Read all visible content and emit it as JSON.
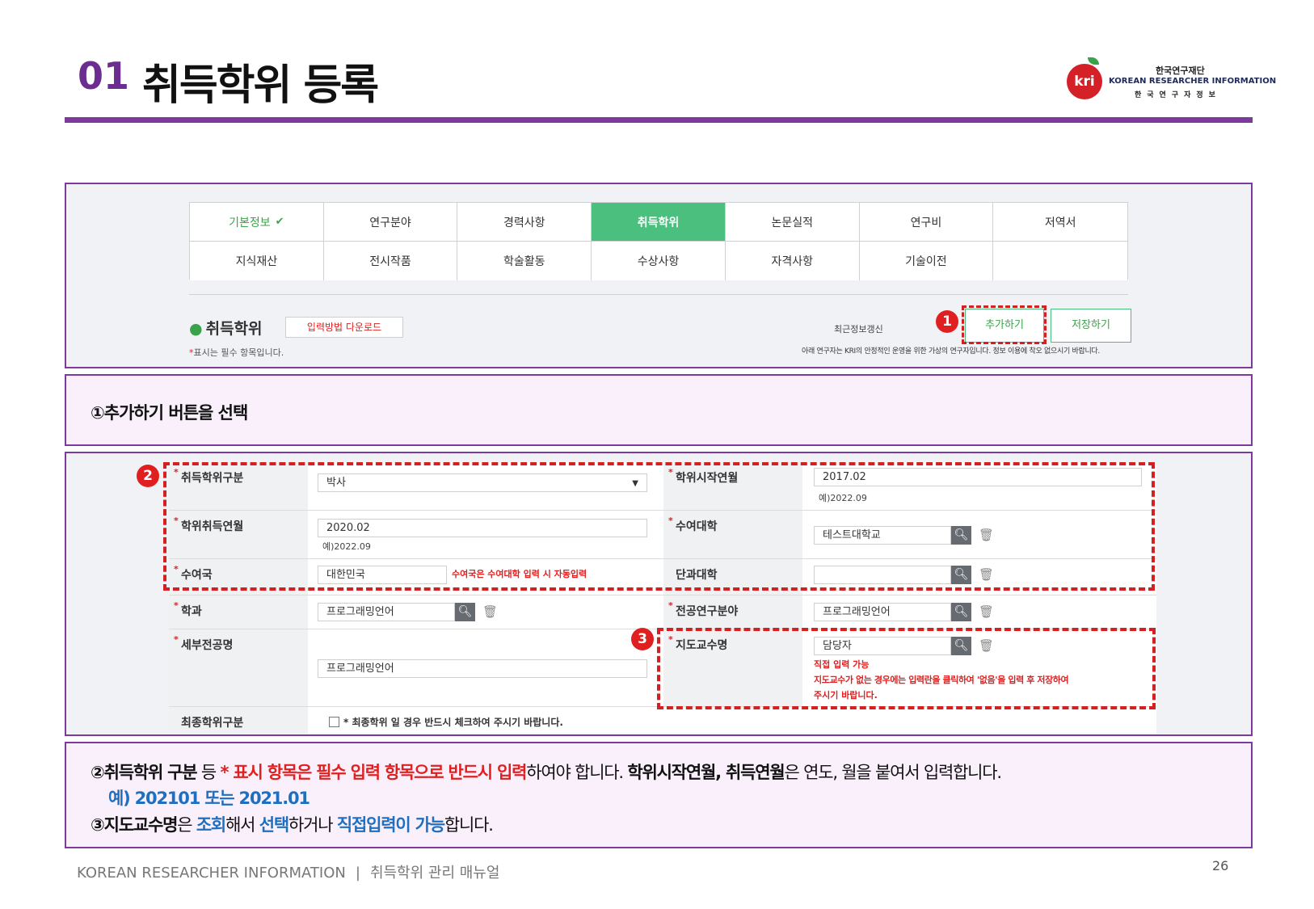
{
  "header": {
    "number": "01",
    "title": "취득학위 등록",
    "logo": {
      "mark": "kri",
      "line1": "한국연구재단",
      "line2": "KOREAN RESEARCHER INFORMATION",
      "line3": "한국연구자정보"
    }
  },
  "tabs": [
    {
      "label": "기본정보",
      "state": "done"
    },
    {
      "label": "연구분야",
      "state": "normal"
    },
    {
      "label": "경력사항",
      "state": "normal"
    },
    {
      "label": "취득학위",
      "state": "active"
    },
    {
      "label": "논문실적",
      "state": "normal"
    },
    {
      "label": "연구비",
      "state": "normal"
    },
    {
      "label": "저역서",
      "state": "normal"
    },
    {
      "label": "지식재산",
      "state": "normal"
    },
    {
      "label": "전시작품",
      "state": "normal"
    },
    {
      "label": "학술활동",
      "state": "normal"
    },
    {
      "label": "수상사항",
      "state": "normal"
    },
    {
      "label": "자격사항",
      "state": "normal"
    },
    {
      "label": "기술이전",
      "state": "normal"
    },
    {
      "label": "",
      "state": "normal"
    }
  ],
  "section": {
    "title": "취득학위",
    "download_label": "입력방법 다운로드",
    "required_note": "표시는 필수 항목입니다.",
    "recent_update": "최근정보갱신",
    "add_button": "추가하기",
    "save_button": "저장하기",
    "notice": "아래 연구자는 KRI의 안정적인 운영을 위한 가상의 연구자입니다. 정보 이용에 착오 없으시기 바랍니다."
  },
  "badges": {
    "one": "1",
    "two": "2",
    "three": "3"
  },
  "instruction1": "①추가하기 버튼을 선택",
  "form": {
    "degree_type": {
      "label": "취득학위구분",
      "value": "박사"
    },
    "degree_start": {
      "label": "학위시작연월",
      "value": "2017.02",
      "hint": "예)2022.09"
    },
    "degree_acquired": {
      "label": "학위취득연월",
      "value": "2020.02",
      "hint": "예)2022.09"
    },
    "university": {
      "label": "수여대학",
      "value": "테스트대학교"
    },
    "country": {
      "label": "수여국",
      "value": "대한민국",
      "note": "수여국은 수여대학 입력 시 자동입력"
    },
    "college": {
      "label": "단과대학",
      "value": ""
    },
    "department": {
      "label": "학과",
      "value": "프로그래밍언어"
    },
    "research_field": {
      "label": "전공연구분야",
      "value": "프로그래밍언어"
    },
    "sub_major": {
      "label": "세부전공명",
      "value": "프로그래밍언어"
    },
    "advisor": {
      "label": "지도교수명",
      "value": "담당자",
      "note1": "직접 입력 가능",
      "note2": "지도교수가 없는 경우에는 입력란을 클릭하여 '없음'을 입력 후 저장하여",
      "note3": "주시기 바랍니다."
    },
    "final_degree": {
      "label": "최종학위구분",
      "checkbox_label": "* 최종학위 일 경우 반드시 체크하여 주시기 바랍니다."
    }
  },
  "instruction2": {
    "p1": "②",
    "p2": "취득학위 구분",
    "p3": " 등 ",
    "p4": "* 표시 항목은 필수 입력 항목으로 반드시 입력",
    "p5": "하여야 합니다. ",
    "p6": "학위시작연월, 취득연월",
    "p7": "은 연도, 월을 붙여서 입력합니다."
  },
  "instruction2b": "예) 202101 또는 2021.01",
  "instruction3": {
    "p1": "③",
    "p2": "지도교수명",
    "p3": "은 ",
    "p4": "조회",
    "p5": "해서 ",
    "p6": "선택",
    "p7": "하거나 ",
    "p8": "직접입력이 가능",
    "p9": "합니다."
  },
  "footer": {
    "left": "KOREAN RESEARCHER INFORMATION",
    "separator": "|",
    "manual": "취득학위 관리 매뉴얼",
    "page": "26"
  },
  "colors": {
    "brand_purple": "#7b3a9c",
    "active_tab": "#4bbf7e",
    "highlight_red": "#d42020",
    "link_blue": "#1f6fc0"
  },
  "icons": {
    "search": "search-icon",
    "trash": "trash-icon",
    "check": "check-icon",
    "dropdown": "chevron-down-icon"
  }
}
